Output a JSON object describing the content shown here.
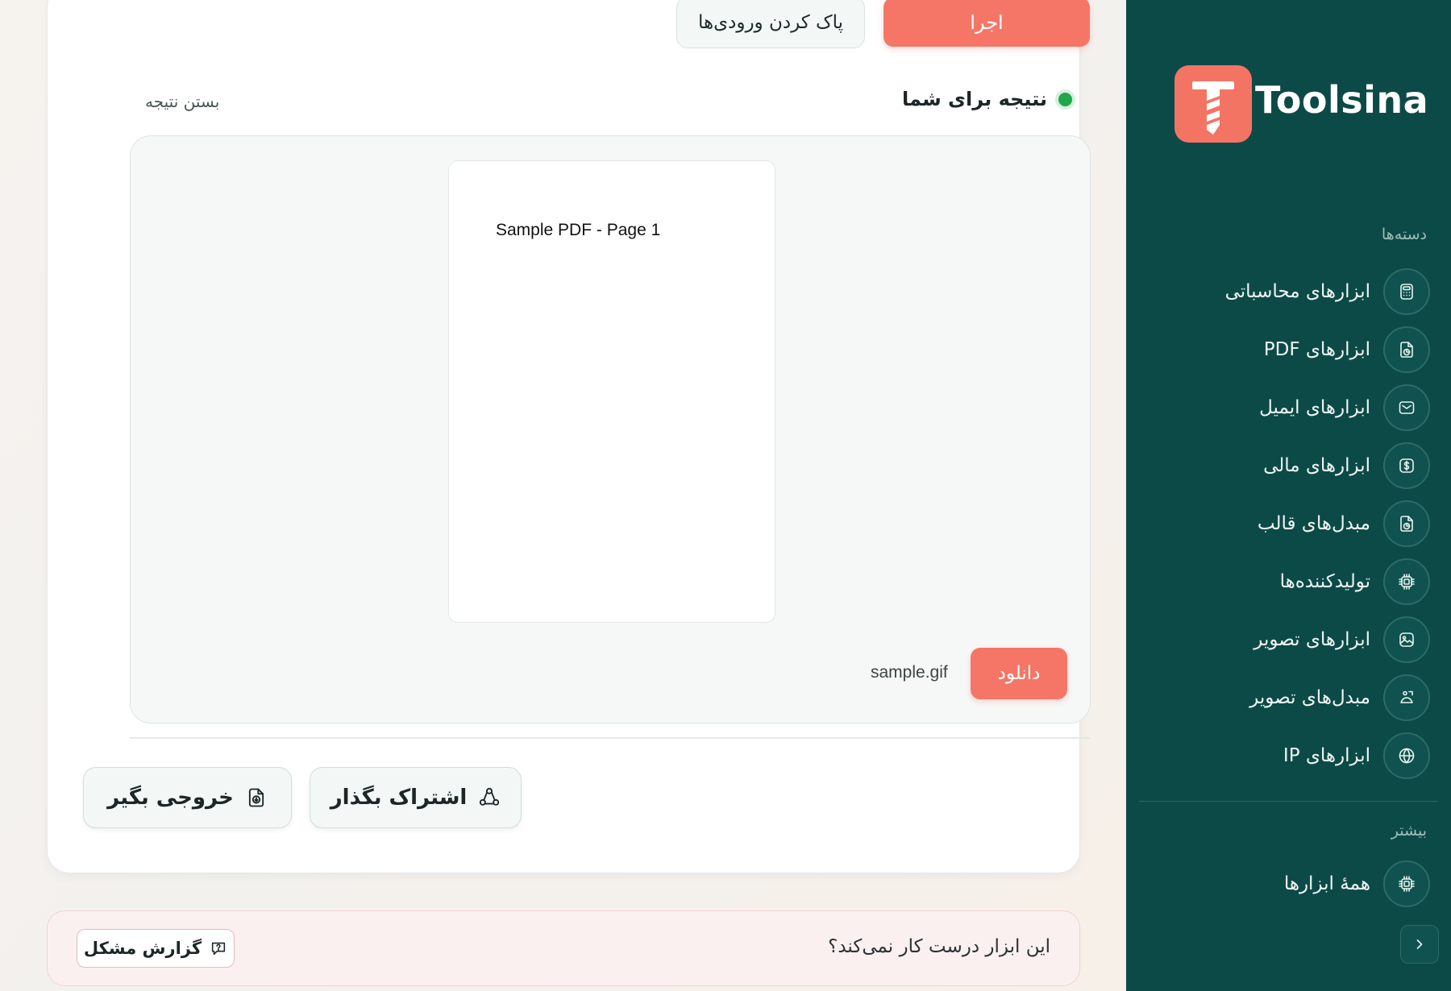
{
  "brand": {
    "name": "Toolsina",
    "accent": "#f57667",
    "sidebar_bg": "#0c4a47"
  },
  "toolbar": {
    "run_label": "اجرا",
    "clear_label": "پاک کردن ورودی‌ها"
  },
  "result": {
    "title": "نتیجه برای شما",
    "close_label": "بستن نتیجه",
    "status_color": "#21a64a",
    "preview_text": "Sample PDF - Page 1",
    "download_label": "دانلود",
    "file_name": "sample.gif",
    "share_label": "اشتراک بگذار",
    "export_label": "خروجی بگیر"
  },
  "report": {
    "question": "این ابزار درست کار نمی‌کند؟",
    "button_label": "گزارش مشکل"
  },
  "sidebar": {
    "categories_title": "دسته‌ها",
    "items": [
      {
        "label": "ابزارهای محاسباتی",
        "icon": "calculator-icon"
      },
      {
        "label": "ابزارهای PDF",
        "icon": "file-chart-icon"
      },
      {
        "label": "ابزارهای ایمیل",
        "icon": "mail-icon"
      },
      {
        "label": "ابزارهای مالی",
        "icon": "dollar-icon"
      },
      {
        "label": "مبدل‌های قالب",
        "icon": "file-convert-icon"
      },
      {
        "label": "تولیدکننده‌ها",
        "icon": "chip-icon"
      },
      {
        "label": "ابزارهای تصویر",
        "icon": "image-icon"
      },
      {
        "label": "مبدل‌های تصویر",
        "icon": "image-convert-icon"
      },
      {
        "label": "ابزارهای IP",
        "icon": "globe-icon"
      }
    ],
    "more_title": "بیشتر",
    "more_items": [
      {
        "label": "همهٔ ابزارها",
        "icon": "chip-icon"
      }
    ]
  }
}
